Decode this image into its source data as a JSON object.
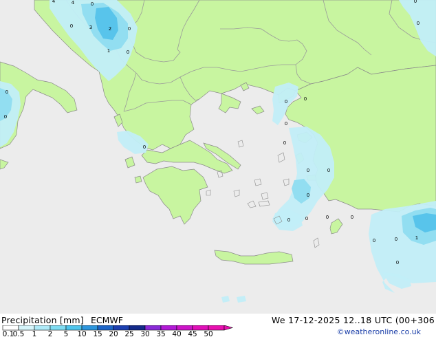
{
  "map": {
    "colors": {
      "sea": "#ececec",
      "land": "#c8f5a0",
      "border": "#9a9a9a",
      "coast": "#8a8a8a",
      "precip_light": "#c2eef8",
      "precip_medium": "#8fdcf0",
      "precip_heavy": "#55c2ea"
    },
    "precip_labels": [
      {
        "id": "adriatic-1",
        "text": "4"
      },
      {
        "id": "adriatic-2",
        "text": "4"
      },
      {
        "id": "adriatic-3",
        "text": "0"
      },
      {
        "id": "adriatic-4",
        "text": "0"
      },
      {
        "id": "adriatic-5",
        "text": "3"
      },
      {
        "id": "adriatic-6",
        "text": "2"
      },
      {
        "id": "adriatic-7",
        "text": "0"
      },
      {
        "id": "adriatic-8",
        "text": "1"
      },
      {
        "id": "adriatic-9",
        "text": "0"
      },
      {
        "id": "italy-1",
        "text": "0"
      },
      {
        "id": "italy-2",
        "text": "0"
      },
      {
        "id": "ionian-1",
        "text": "0"
      },
      {
        "id": "aegean-1",
        "text": "0"
      },
      {
        "id": "aegean-2",
        "text": "0"
      },
      {
        "id": "aegean-3",
        "text": "0"
      },
      {
        "id": "aegean-4",
        "text": "0"
      },
      {
        "id": "aegean-5",
        "text": "0"
      },
      {
        "id": "aegean-6",
        "text": "0"
      },
      {
        "id": "aegean-7",
        "text": "0"
      },
      {
        "id": "aegean-8",
        "text": "0"
      },
      {
        "id": "aegean-9",
        "text": "0"
      },
      {
        "id": "aegean-10",
        "text": "0"
      },
      {
        "id": "rhodes-1",
        "text": "0"
      },
      {
        "id": "levant-1",
        "text": "0"
      },
      {
        "id": "levant-2",
        "text": "0"
      },
      {
        "id": "levant-3",
        "text": "1"
      },
      {
        "id": "levant-4",
        "text": "0"
      },
      {
        "id": "blacksea-1",
        "text": "0"
      },
      {
        "id": "blacksea-2",
        "text": "0"
      }
    ]
  },
  "legend": {
    "title": "Precipitation [mm]",
    "model": "ECMWF",
    "date": "We 17-12-2025 12..18 UTC (00+306",
    "credit": "©weatheronline.co.uk",
    "scale_labels": [
      "0.1",
      "0.5",
      "1",
      "2",
      "5",
      "10",
      "15",
      "20",
      "25",
      "30",
      "35",
      "40",
      "45",
      "50"
    ],
    "scale_colors": [
      "#ffffff",
      "#d6f5fb",
      "#aeeaf8",
      "#7fdcf2",
      "#4fc5ec",
      "#2d96dd",
      "#1e66c8",
      "#1c3fb0",
      "#142a8a",
      "#8a2bd8",
      "#b21ad6",
      "#cc14c8",
      "#e010b8",
      "#e810b0"
    ]
  }
}
